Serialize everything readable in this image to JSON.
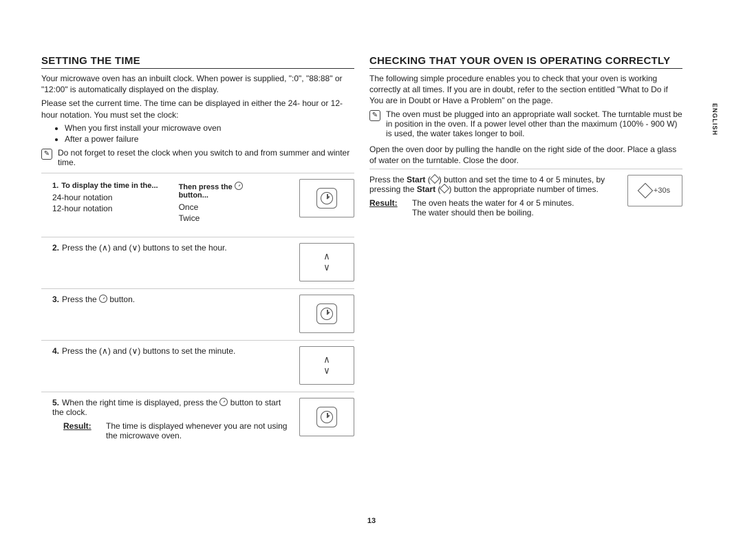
{
  "sideLabel": "ENGLISH",
  "pageNumber": "13",
  "left": {
    "heading": "SETTING THE TIME",
    "intro1": "Your microwave oven has an inbuilt clock. When power is supplied, \":0\", \"88:88\" or \"12:00\" is automatically displayed on the display.",
    "intro2": "Please set the current time. The time can be displayed in either the 24- hour or 12-hour notation. You must set the clock:",
    "bullets": [
      "When you first install your microwave oven",
      "After a power failure"
    ],
    "note": "Do not forget to reset the clock when you switch to and from summer and winter time.",
    "step1": {
      "hd1": "To display the time in the...",
      "hd2": "Then press the",
      "hd2suffix": "button...",
      "r1c1": "24-hour notation",
      "r1c2": "Once",
      "r2c1": "12-hour notation",
      "r2c2": "Twice"
    },
    "step2": "Press the (∧) and (∨) buttons to set the hour.",
    "step3a": "Press the ",
    "step3b": " button.",
    "step4": "Press the (∧) and (∨) buttons to set the minute.",
    "step5a": "When the right time is displayed, press the ",
    "step5b": " button to start the clock.",
    "resultLbl": "Result:",
    "resultTxt": "The time is displayed whenever you are not using the microwave oven."
  },
  "right": {
    "heading": "CHECKING THAT YOUR OVEN IS OPERATING CORRECTLY",
    "intro": "The following simple procedure enables you to check that your oven is working correctly at all times. If you are in doubt, refer to the section entitled \"What to Do if You are in Doubt or Have a Problem\" on the page.",
    "note": "The oven must be plugged into an appropriate wall socket. The turntable must be in position in the oven. If a power level other than the maximum (100% - 900 W) is used, the water takes longer to boil.",
    "p1": "Open the oven door by pulling the handle on the right side of the door. Place a glass of water on the turntable. Close the door.",
    "p2a": "Press the ",
    "p2start": "Start",
    "p2b": " (",
    "p2c": ") button and set the time to 4 or 5 minutes, by pressing the ",
    "p2d": " (",
    "p2e": ") button the appropriate number of times.",
    "startBtnLabel": "+30s",
    "resultLbl": "Result:",
    "result1": "The oven heats the water for 4 or 5 minutes.",
    "result2": "The water should then be boiling."
  }
}
